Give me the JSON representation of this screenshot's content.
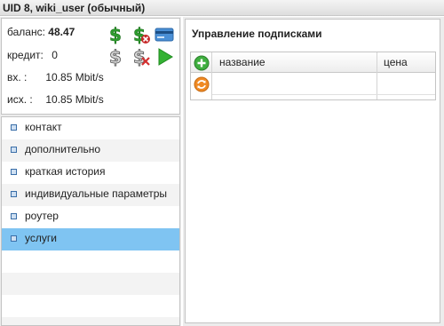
{
  "window": {
    "title": "UID 8, wiki_user (обычный)"
  },
  "account": {
    "balance_label": "баланс:",
    "balance_value": "48.47",
    "credit_label": "кредит:",
    "credit_value": "0",
    "in_label": "вх.   :",
    "in_value": "10.85  Mbit/s",
    "out_label": "исх. :",
    "out_value": "10.85  Mbit/s"
  },
  "toolbar_icons": [
    "dollar-icon",
    "dollar-delete-icon",
    "credit-card-icon",
    "dollar-gray-icon",
    "dollar-gray-delete-icon",
    "play-icon"
  ],
  "nav": {
    "items": [
      {
        "label": "контакт"
      },
      {
        "label": "дополнительно"
      },
      {
        "label": "краткая история"
      },
      {
        "label": "индивидуальные параметры"
      },
      {
        "label": "роутер"
      },
      {
        "label": "услуги"
      }
    ],
    "selected": "услуги"
  },
  "subscriptions": {
    "title": "Управление подписками",
    "columns": [
      "название",
      "цена"
    ],
    "rows": []
  },
  "colors": {
    "accent_selected": "#7fc4f2",
    "dollar_green": "#2e9e2e",
    "play_green": "#34b233"
  }
}
